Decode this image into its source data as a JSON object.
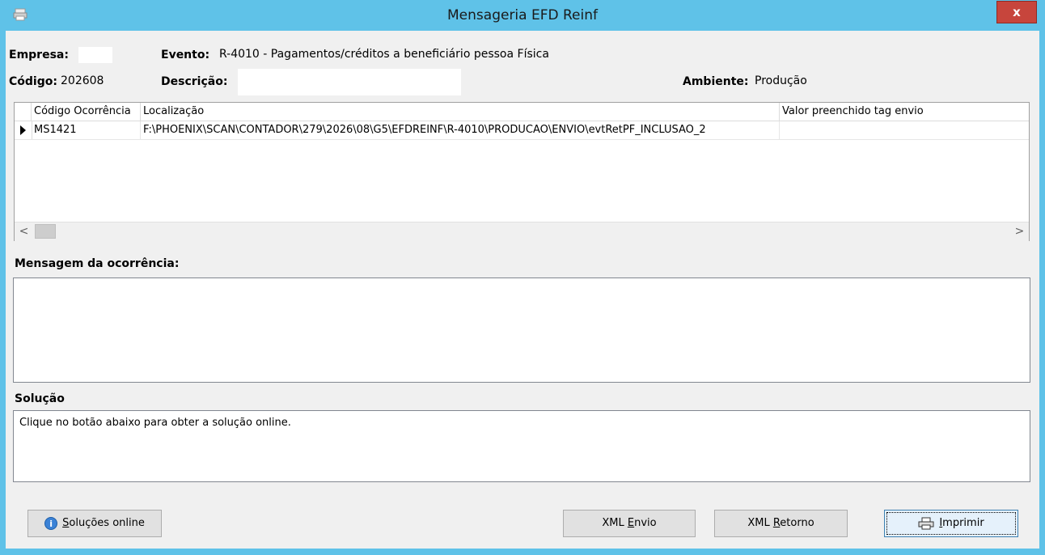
{
  "window": {
    "title": "Mensageria EFD Reinf",
    "close_label": "x"
  },
  "header": {
    "empresa_label": "Empresa:",
    "evento_label": "Evento:",
    "evento_value": "R-4010 - Pagamentos/créditos a beneficiário pessoa Física",
    "codigo_label": "Código:",
    "codigo_value": "202608",
    "descricao_label": "Descrição:",
    "ambiente_label": "Ambiente:",
    "ambiente_value": "Produção"
  },
  "grid": {
    "columns": [
      "Código Ocorrência",
      "Localização",
      "Valor preenchido tag envio"
    ],
    "rows": [
      {
        "codigo": "MS1421",
        "localizacao": "F:\\PHOENIX\\SCAN\\CONTADOR\\279\\2026\\08\\G5\\EFDREINF\\R-4010\\PRODUCAO\\ENVIO\\evtRetPF_INCLUSAO_2",
        "valor": ""
      }
    ],
    "scroll_left": "<",
    "scroll_right": ">"
  },
  "mensagem": {
    "label": "Mensagem da ocorrência:",
    "text": ""
  },
  "solucao": {
    "label": "Solução",
    "text": "Clique no botão abaixo para obter a solução online."
  },
  "buttons": {
    "solucoes_pre": "",
    "solucoes_u": "S",
    "solucoes_rest": "oluções online",
    "xml_envio_pre": "XML ",
    "xml_envio_u": "E",
    "xml_envio_rest": "nvio",
    "xml_retorno_pre": "XML ",
    "xml_retorno_u": "R",
    "xml_retorno_rest": "etorno",
    "imprimir_pre": "",
    "imprimir_u": "I",
    "imprimir_rest": "mprimir"
  },
  "icons": {
    "app": "printer-app-icon",
    "info": "info-icon",
    "print": "printer-icon"
  }
}
